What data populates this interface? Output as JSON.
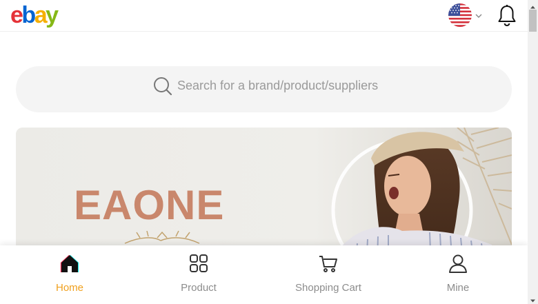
{
  "header": {
    "logo_letters": [
      "e",
      "b",
      "a",
      "y"
    ],
    "logo_colors": [
      "#e53238",
      "#0064d2",
      "#f5af02",
      "#86b817"
    ],
    "flag_icon": "us-flag-icon",
    "language_chevron_icon": "chevron-down-icon",
    "notification_icon": "bell-icon"
  },
  "search": {
    "placeholder": "Search for a brand/product/suppliers",
    "icon": "search-icon"
  },
  "banner": {
    "brand_text": "EAONE"
  },
  "bottom_nav": {
    "active_color": "#f0a01e",
    "inactive_color": "#8c8c8c",
    "items": [
      {
        "label": "Home",
        "icon": "home-icon",
        "active": true
      },
      {
        "label": "Product",
        "icon": "grid-icon",
        "active": false
      },
      {
        "label": "Shopping Cart",
        "icon": "cart-icon",
        "active": false
      },
      {
        "label": "Mine",
        "icon": "user-icon",
        "active": false
      }
    ]
  }
}
